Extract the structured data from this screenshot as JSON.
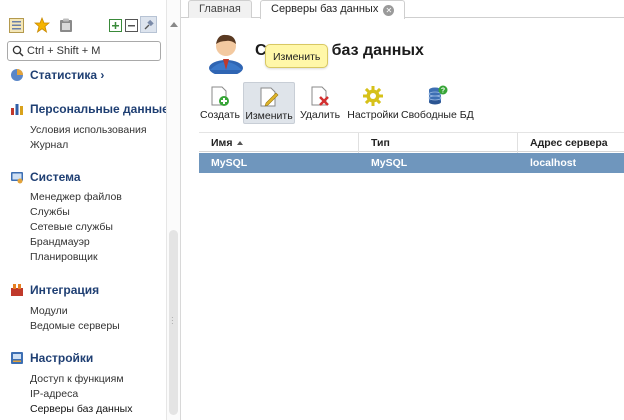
{
  "search": {
    "placeholder": "Ctrl + Shift + M"
  },
  "sidebar": {
    "groups": [
      {
        "title": "Статистика ›",
        "icon": "statistics-icon",
        "items": []
      },
      {
        "title": "Персональные данные",
        "icon": "bar-chart-icon",
        "items": [
          "Условия использования",
          "Журнал"
        ]
      },
      {
        "title": "Система",
        "icon": "system-icon",
        "items": [
          "Менеджер файлов",
          "Службы",
          "Сетевые службы",
          "Брандмауэр",
          "Планировщик"
        ]
      },
      {
        "title": "Интеграция",
        "icon": "integration-icon",
        "items": [
          "Модули",
          "Ведомые серверы"
        ]
      },
      {
        "title": "Настройки",
        "icon": "settings-icon",
        "items": [
          "Доступ к функциям",
          "IP-адреса",
          "Серверы баз данных"
        ]
      }
    ]
  },
  "tabs": [
    {
      "label": "Главная"
    },
    {
      "label": "Серверы баз данных"
    }
  ],
  "page": {
    "title": "Серверы баз данных"
  },
  "toolbar": {
    "create": "Создать",
    "edit": "Изменить",
    "delete": "Удалить",
    "settings": "Настройки",
    "free_db": "Свободные БД"
  },
  "tooltip": {
    "text": "Изменить"
  },
  "table": {
    "columns": [
      "Имя",
      "Тип",
      "Адрес сервера"
    ],
    "rows": [
      [
        "MySQL",
        "MySQL",
        "localhost"
      ]
    ]
  },
  "colors": {
    "selection": "#6f96bd",
    "accent": "#1f3f73",
    "tooltip": "#fff7a8"
  }
}
